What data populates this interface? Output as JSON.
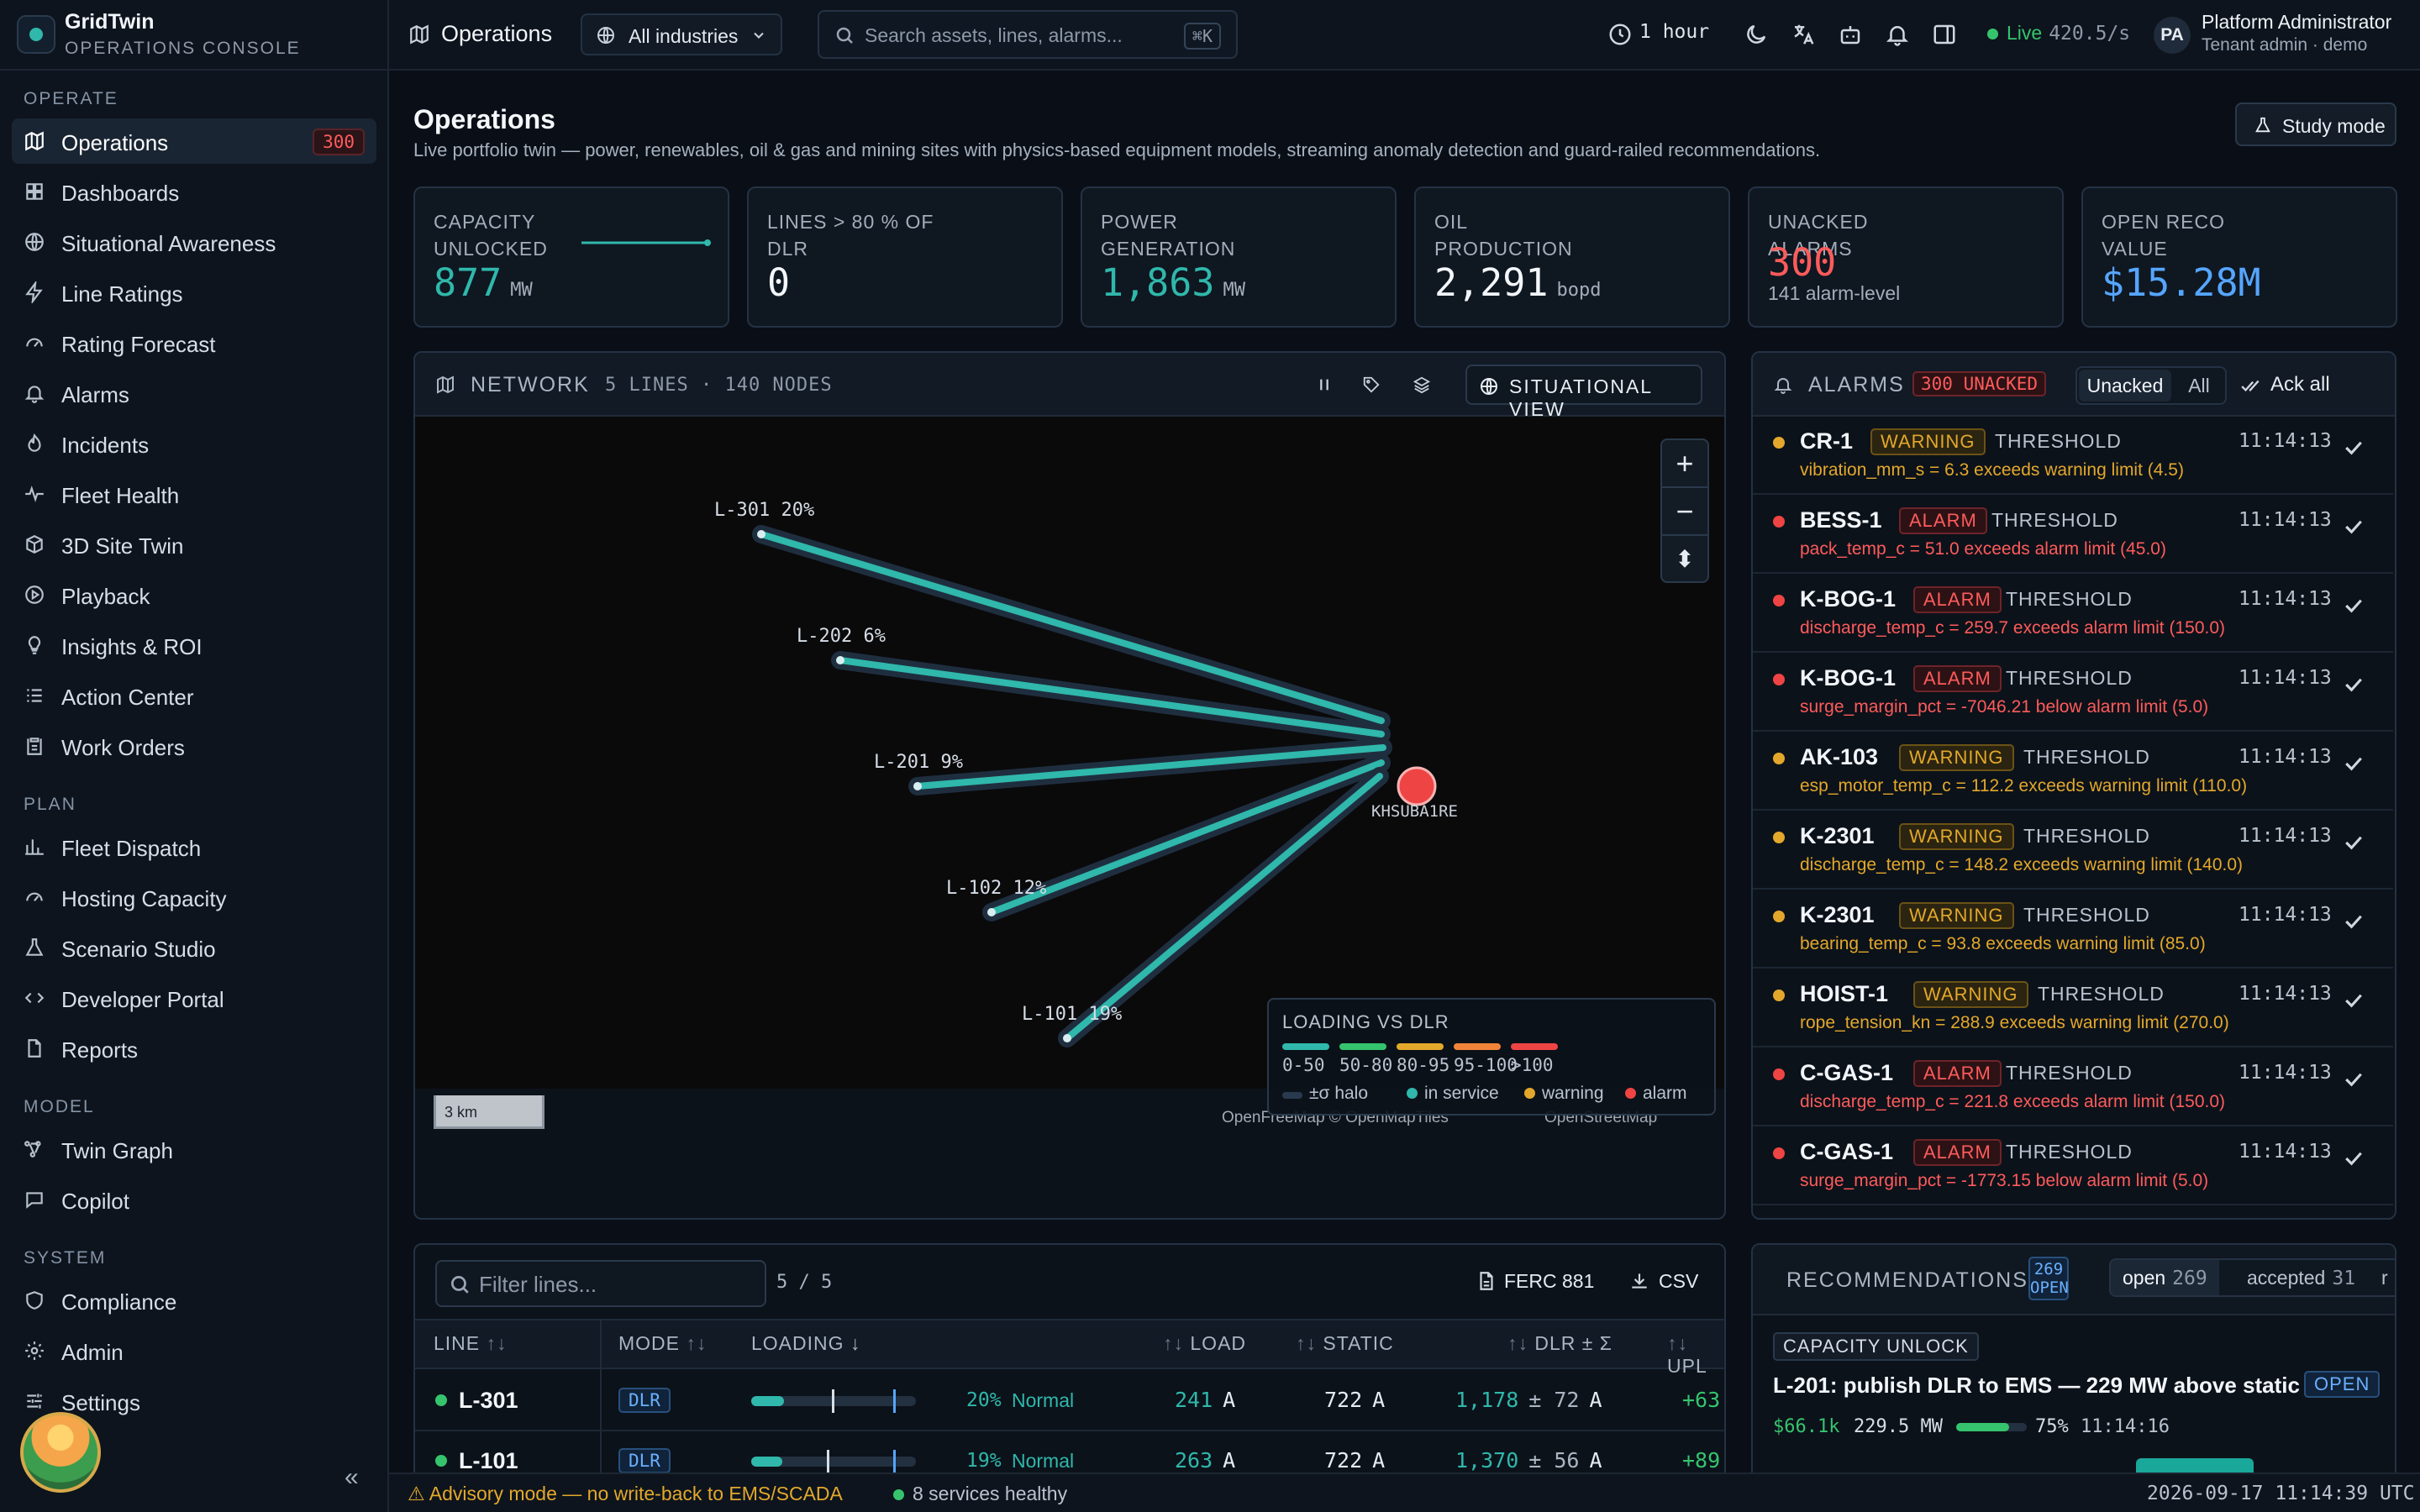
{
  "brand": {
    "name": "GridTwin",
    "subtitle": "OPERATIONS CONSOLE"
  },
  "sidebar": {
    "sections": [
      {
        "title": "OPERATE",
        "items": [
          {
            "label": "Operations",
            "icon": "map-icon",
            "badge": "300",
            "active": true
          },
          {
            "label": "Dashboards",
            "icon": "grid-icon"
          },
          {
            "label": "Situational Awareness",
            "icon": "globe-icon"
          },
          {
            "label": "Line Ratings",
            "icon": "bolt-icon"
          },
          {
            "label": "Rating Forecast",
            "icon": "gauge-icon"
          },
          {
            "label": "Alarms",
            "icon": "bell-icon"
          },
          {
            "label": "Incidents",
            "icon": "flame-icon"
          },
          {
            "label": "Fleet Health",
            "icon": "pulse-icon"
          },
          {
            "label": "3D Site Twin",
            "icon": "cube-icon"
          },
          {
            "label": "Playback",
            "icon": "play-icon"
          },
          {
            "label": "Insights & ROI",
            "icon": "bulb-icon"
          },
          {
            "label": "Action Center",
            "icon": "list-icon"
          },
          {
            "label": "Work Orders",
            "icon": "clipboard-icon"
          }
        ]
      },
      {
        "title": "PLAN",
        "items": [
          {
            "label": "Fleet Dispatch",
            "icon": "chart-icon"
          },
          {
            "label": "Hosting Capacity",
            "icon": "gauge-icon"
          },
          {
            "label": "Scenario Studio",
            "icon": "flask-icon"
          },
          {
            "label": "Developer Portal",
            "icon": "code-icon"
          },
          {
            "label": "Reports",
            "icon": "file-icon"
          }
        ]
      },
      {
        "title": "MODEL",
        "items": [
          {
            "label": "Twin Graph",
            "icon": "nodes-icon"
          },
          {
            "label": "Copilot",
            "icon": "chat-icon"
          }
        ]
      },
      {
        "title": "SYSTEM",
        "items": [
          {
            "label": "Compliance",
            "icon": "shield-icon"
          },
          {
            "label": "Admin",
            "icon": "gear-icon"
          },
          {
            "label": "Settings",
            "icon": "sliders-icon"
          }
        ]
      }
    ],
    "collapse_label": "«"
  },
  "topbar": {
    "title": "Operations",
    "industry": "All industries",
    "search_placeholder": "Search assets, lines, alarms...",
    "search_kbd": "⌘K",
    "time_range": "1 hour",
    "live_label": "Live",
    "live_rate": "420.5/s",
    "user_initials": "PA",
    "user_name": "Platform Administrator",
    "user_role": "Tenant admin · demo"
  },
  "page": {
    "title": "Operations",
    "subtitle": "Live portfolio twin — power, renewables, oil & gas and mining sites with physics-based equipment models, streaming anomaly detection and guard-railed recommendations.",
    "study_mode": "Study mode"
  },
  "kpis": [
    {
      "label": "CAPACITY UNLOCKED",
      "value": "877",
      "unit": "MW",
      "color": "#2fb8ab"
    },
    {
      "label": "LINES > 80 % OF DLR",
      "value": "0",
      "unit": "",
      "color": "#f3f6fa"
    },
    {
      "label": "POWER GENERATION",
      "value": "1,863",
      "unit": "MW",
      "color": "#2fb8ab"
    },
    {
      "label": "OIL PRODUCTION",
      "value": "2,291",
      "unit": "bopd",
      "color": "#f3f6fa"
    },
    {
      "label": "UNACKED ALARMS",
      "value": "300",
      "unit": "",
      "sub": "141 alarm-level",
      "color": "#ff5b5b"
    },
    {
      "label": "OPEN RECO VALUE",
      "value": "$15.28M",
      "unit": "",
      "color": "#55a6ff"
    }
  ],
  "network": {
    "title": "NETWORK",
    "meta": "5 LINES · 140 NODES",
    "view_button": "SITUATIONAL VIEW",
    "lines": [
      {
        "name": "L-301",
        "loading": "20%"
      },
      {
        "name": "L-202",
        "loading": "6%"
      },
      {
        "name": "L-201",
        "loading": "9%"
      },
      {
        "name": "L-102",
        "loading": "12%"
      },
      {
        "name": "L-101",
        "loading": "19%"
      }
    ],
    "substation_label": "KHSUBA1RE",
    "zoom_in": "+",
    "zoom_out": "−",
    "compass": "⬍",
    "scale_label": "3 km",
    "legend": {
      "title": "LOADING VS DLR",
      "bands": [
        {
          "label": "0-50",
          "color": "#2fb8ab"
        },
        {
          "label": "50-80",
          "color": "#35c46d"
        },
        {
          "label": "80-95",
          "color": "#e3a82b"
        },
        {
          "label": "95-100",
          "color": "#f2843a"
        },
        {
          "label": ">100",
          "color": "#ef4444"
        }
      ],
      "halo_label": "±σ halo",
      "in_service": "in service",
      "warning": "warning",
      "alarm": "alarm"
    },
    "attribution_1": "OpenFreeMap © OpenMapTiles",
    "attribution_2": "OpenStreetMap"
  },
  "alarms": {
    "title": "ALARMS",
    "unacked_badge": "300 UNACKED",
    "filter_unacked": "Unacked",
    "filter_all": "All",
    "ack_all": "Ack all",
    "items": [
      {
        "asset": "CR-1",
        "severity": "WARNING",
        "type": "THRESHOLD",
        "time": "11:14:13",
        "message": "vibration_mm_s = 6.3 exceeds warning limit (4.5)"
      },
      {
        "asset": "BESS-1",
        "severity": "ALARM",
        "type": "THRESHOLD",
        "time": "11:14:13",
        "message": "pack_temp_c = 51.0 exceeds alarm limit (45.0)"
      },
      {
        "asset": "K-BOG-1",
        "severity": "ALARM",
        "type": "THRESHOLD",
        "time": "11:14:13",
        "message": "discharge_temp_c = 259.7 exceeds alarm limit (150.0)"
      },
      {
        "asset": "K-BOG-1",
        "severity": "ALARM",
        "type": "THRESHOLD",
        "time": "11:14:13",
        "message": "surge_margin_pct = -7046.21 below alarm limit (5.0)"
      },
      {
        "asset": "AK-103",
        "severity": "WARNING",
        "type": "THRESHOLD",
        "time": "11:14:13",
        "message": "esp_motor_temp_c = 112.2 exceeds warning limit (110.0)"
      },
      {
        "asset": "K-2301",
        "severity": "WARNING",
        "type": "THRESHOLD",
        "time": "11:14:13",
        "message": "discharge_temp_c = 148.2 exceeds warning limit (140.0)"
      },
      {
        "asset": "K-2301",
        "severity": "WARNING",
        "type": "THRESHOLD",
        "time": "11:14:13",
        "message": "bearing_temp_c = 93.8 exceeds warning limit (85.0)"
      },
      {
        "asset": "HOIST-1",
        "severity": "WARNING",
        "type": "THRESHOLD",
        "time": "11:14:13",
        "message": "rope_tension_kn = 288.9 exceeds warning limit (270.0)"
      },
      {
        "asset": "C-GAS-1",
        "severity": "ALARM",
        "type": "THRESHOLD",
        "time": "11:14:13",
        "message": "discharge_temp_c = 221.8 exceeds alarm limit (150.0)"
      },
      {
        "asset": "C-GAS-1",
        "severity": "ALARM",
        "type": "THRESHOLD",
        "time": "11:14:13",
        "message": "surge_margin_pct = -1773.15 below alarm limit (5.0)"
      }
    ]
  },
  "lines_table": {
    "filter_placeholder": "Filter lines...",
    "count": "5 / 5",
    "ferc_button": "FERC 881",
    "csv_button": "CSV",
    "columns": {
      "line": "LINE",
      "mode": "MODE",
      "loading": "LOADING",
      "load": "LOAD",
      "static": "STATIC",
      "dlr": "DLR ± Σ",
      "upl": "UPL"
    },
    "sort_both": "↑↓",
    "sort_desc": "↓",
    "rows": [
      {
        "line": "L-301",
        "mode": "DLR",
        "loading_pct": "20%",
        "loading": 0.2,
        "static_ratio": 0.52,
        "state": "Normal",
        "load": "241",
        "load_unit": "A",
        "static": "722",
        "static_unit": "A",
        "dlr": "1,178",
        "sigma": "± 72",
        "dlr_unit": "A",
        "upl": "+63."
      },
      {
        "line": "L-101",
        "mode": "DLR",
        "loading_pct": "19%",
        "loading": 0.19,
        "static_ratio": 0.49,
        "state": "Normal",
        "load": "263",
        "load_unit": "A",
        "static": "722",
        "static_unit": "A",
        "dlr": "1,370",
        "sigma": "± 56",
        "dlr_unit": "A",
        "upl": "+89."
      }
    ]
  },
  "recommendations": {
    "title": "RECOMMENDATIONS",
    "open_badge_1": "269",
    "open_badge_2": "OPEN",
    "tabs": [
      {
        "label": "open",
        "count": "269",
        "active": true
      },
      {
        "label": "accepted",
        "count": "31"
      },
      {
        "label": "r",
        "count": ""
      }
    ],
    "card": {
      "category": "CAPACITY UNLOCK",
      "title": "L-201: publish DLR to EMS — 229 MW above static",
      "status": "OPEN",
      "value": "$66.1k",
      "mw": "229.5 MW",
      "confidence_pct": "75%",
      "confidence": 0.75,
      "time": "11:14:16"
    }
  },
  "footer": {
    "advisory": "Advisory mode — no write-back to EMS/SCADA",
    "services": "8 services healthy",
    "clock": "2026-09-17 11:14:39 UTC"
  }
}
